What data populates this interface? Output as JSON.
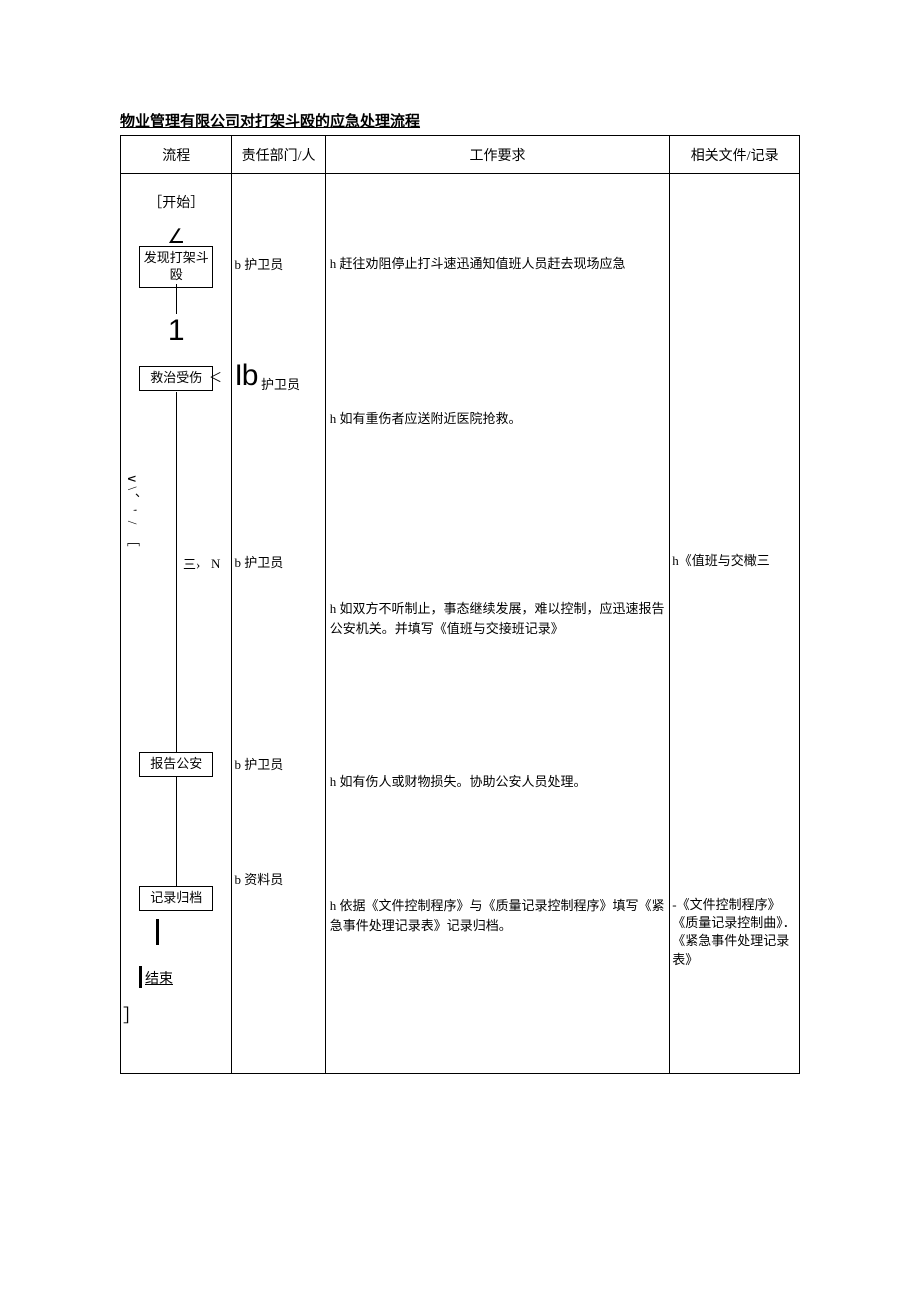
{
  "title": "物业管理有限公司对打架斗殴的应急处理流程",
  "headers": {
    "col1": "流程",
    "col2": "责任部门/人",
    "col3": "工作要求",
    "col4": "相关文件/记录"
  },
  "flow": {
    "start": "［开始］",
    "angle": "∠",
    "box1": "发现打架斗殴",
    "n1": "1",
    "box2": "救治受伤",
    "lt": "＜",
    "ib": "Ib",
    "ib_role": "护卫员",
    "side_chars": "∨\\、' / ［",
    "san": "三›",
    "N": "N",
    "box3": "报告公安",
    "box4": "记录归档",
    "bar1": "▎",
    "end": "结束",
    "bracket": "］"
  },
  "resp": {
    "r1": "b 护卫员",
    "r2": "b 护卫员",
    "r3": "b 护卫员",
    "r4": "b 资料员"
  },
  "req": {
    "q1": "h 赶往劝阻停止打斗速迅通知值班人员赶去现场应急",
    "q2": "h 如有重伤者应送附近医院抢救。",
    "q3": "h 如双方不听制止，事态继续发展，难以控制，应迅速报告公安机关。并填写《值班与交接班记录》",
    "q4": "h 如有伤人或财物损失。协助公安人员处理。",
    "q5": "h 依据《文件控制程序》与《质量记录控制程序》填写《紧急事件处理记录表》记录归档。"
  },
  "docs": {
    "d1": "h《值班与交橄三",
    "d2": "-《文件控制程序》《质量记录控制曲》．《紧急事件处理记录表》"
  }
}
